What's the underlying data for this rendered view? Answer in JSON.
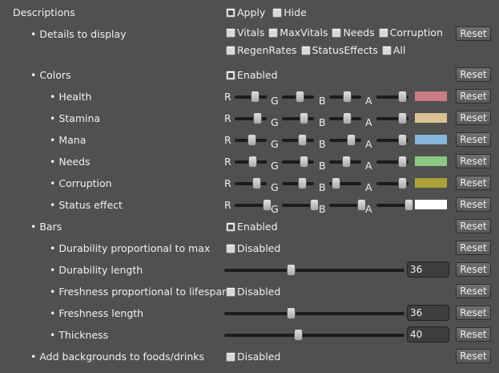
{
  "descriptions": {
    "label": "Descriptions",
    "apply_label": "Apply",
    "hide_label": "Hide",
    "apply_checked": true,
    "hide_checked": false
  },
  "details": {
    "label": "• Details to display",
    "options_row1": [
      "Vitals",
      "MaxVitals",
      "Needs",
      "Corruption"
    ],
    "options_row2": [
      "RegenRates",
      "StatusEffects",
      "All"
    ],
    "reset_label": "Reset"
  },
  "colors": {
    "label": "• Colors",
    "toggle_label": "Enabled",
    "toggle_checked": true,
    "reset_label": "Reset",
    "channel_letters": [
      "R",
      "G",
      "B",
      "A"
    ],
    "items": [
      {
        "label": "• Health",
        "swatch": "#c97d82",
        "rgba": [
          0.62,
          0.55,
          0.55,
          0.8
        ]
      },
      {
        "label": "• Stamina",
        "swatch": "#d8c393",
        "rgba": [
          0.7,
          0.68,
          0.55,
          0.8
        ]
      },
      {
        "label": "• Mana",
        "swatch": "#88b6d8",
        "rgba": [
          0.52,
          0.62,
          0.68,
          0.8
        ]
      },
      {
        "label": "• Needs",
        "swatch": "#8cc882",
        "rgba": [
          0.55,
          0.68,
          0.52,
          0.8
        ]
      },
      {
        "label": "• Corruption",
        "swatch": "#aaa237",
        "rgba": [
          0.67,
          0.63,
          0.2,
          0.8
        ]
      },
      {
        "label": "• Status effect",
        "swatch": "#ffffff",
        "rgba": [
          1.0,
          1.0,
          1.0,
          1.0
        ]
      }
    ]
  },
  "bars": {
    "label": "• Bars",
    "toggle_label": "Enabled",
    "toggle_checked": true,
    "reset_label": "Reset",
    "items": [
      {
        "label": "• Durability proportional to max",
        "type": "check",
        "value": "Disabled",
        "checked": false
      },
      {
        "label": "• Durability length",
        "type": "slider",
        "value": "36",
        "fraction": 0.37
      },
      {
        "label": "• Freshness proportional to lifespan",
        "type": "check",
        "value": "Disabled",
        "checked": false
      },
      {
        "label": "• Freshness length",
        "type": "slider",
        "value": "36",
        "fraction": 0.37
      },
      {
        "label": "• Thickness",
        "type": "slider",
        "value": "40",
        "fraction": 0.41
      }
    ]
  },
  "backgrounds": {
    "label": "• Add backgrounds to foods/drinks",
    "value": "Disabled",
    "checked": false,
    "reset_label": "Reset"
  }
}
